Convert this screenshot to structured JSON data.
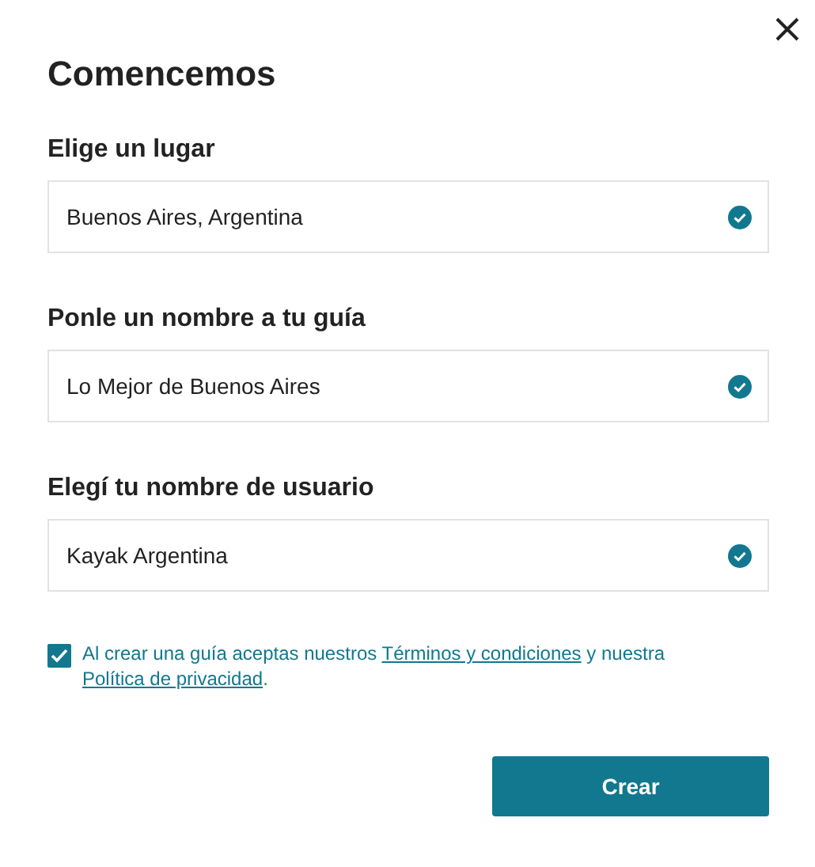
{
  "title": "Comencemos",
  "fields": [
    {
      "label": "Elige un lugar",
      "value": "Buenos Aires, Argentina",
      "valid": true
    },
    {
      "label": "Ponle un nombre a tu guía",
      "value": "Lo Mejor de Buenos Aires",
      "valid": true
    },
    {
      "label": "Elegí tu nombre de usuario",
      "value": "Kayak Argentina",
      "valid": true
    }
  ],
  "consent": {
    "checked": true,
    "parts": [
      {
        "kind": "text",
        "text": "Al crear una guía aceptas nuestros "
      },
      {
        "kind": "link",
        "text": "Términos y condiciones"
      },
      {
        "kind": "text",
        "text": " y nuestra "
      },
      {
        "kind": "link",
        "text": "Política de privacidad"
      },
      {
        "kind": "text",
        "text": "."
      }
    ]
  },
  "submit": "Crear"
}
